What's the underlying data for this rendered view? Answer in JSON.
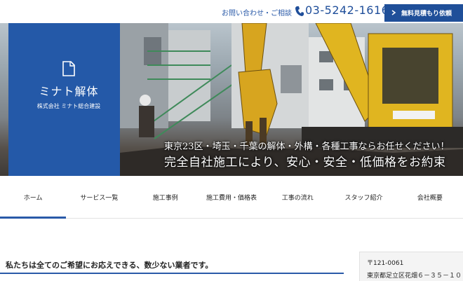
{
  "header": {
    "contact_label": "お問い合わせ・ご相談",
    "phone_icon": "phone-icon",
    "phone_number": "03-5242-1616",
    "estimate_button": "無料見積もり依頼",
    "estimate_icon": "chevron-right-icon"
  },
  "logo": {
    "icon": "document-icon",
    "name": "ミナト解体",
    "company": "株式会社 ミナト総合建設"
  },
  "hero": {
    "tagline_line1": "東京23区・埼玉・千葉の解体・外構・各種工事ならお任せください！",
    "tagline_line2": "完全自社施工により、安心・安全・低価格をお約束"
  },
  "nav": {
    "items": [
      {
        "label": "ホーム"
      },
      {
        "label": "サービス一覧"
      },
      {
        "label": "施工事例"
      },
      {
        "label": "施工費用・価格表"
      },
      {
        "label": "工事の流れ"
      },
      {
        "label": "スタッフ紹介"
      },
      {
        "label": "会社概要"
      }
    ]
  },
  "main": {
    "lead": "私たちは全てのご希望にお応えできる、数少ない業者です。"
  },
  "sidebar": {
    "zip": "〒121-0061",
    "address": "東京都足立区花畑６－３５－１０"
  },
  "colors": {
    "brand_blue": "#2459a8",
    "accent_blue": "#2a5aa8"
  }
}
